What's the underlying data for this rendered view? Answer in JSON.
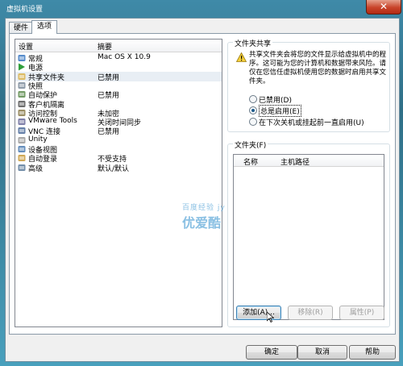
{
  "window": {
    "title": "虚拟机设置",
    "close": "✕"
  },
  "tabs": [
    {
      "label": "硬件"
    },
    {
      "label": "选项"
    }
  ],
  "list": {
    "headers": {
      "setting": "设置",
      "summary": "摘要"
    },
    "items": [
      {
        "name": "常规",
        "value": "Mac OS X 10.9",
        "icon": "general-icon",
        "color": "#3a78c2"
      },
      {
        "name": "电源",
        "value": "",
        "icon": "power-play-icon",
        "color": "#2e9e3a"
      },
      {
        "name": "共享文件夹",
        "value": "已禁用",
        "icon": "shared-folder-icon",
        "color": "#d9b24a"
      },
      {
        "name": "快照",
        "value": "",
        "icon": "snapshot-icon",
        "color": "#7a8a99"
      },
      {
        "name": "自动保护",
        "value": "已禁用",
        "icon": "autoprotect-icon",
        "color": "#5a8a4a"
      },
      {
        "name": "客户机隔离",
        "value": "",
        "icon": "isolation-icon",
        "color": "#555555"
      },
      {
        "name": "访问控制",
        "value": "未加密",
        "icon": "access-control-icon",
        "color": "#8a7a4a"
      },
      {
        "name": "VMware Tools",
        "value": "关闭时间同步",
        "icon": "vmware-tools-icon",
        "color": "#6a6a9a"
      },
      {
        "name": "VNC 连接",
        "value": "已禁用",
        "icon": "vnc-icon",
        "color": "#4a6a9a"
      },
      {
        "name": "Unity",
        "value": "",
        "icon": "unity-icon",
        "color": "#999999"
      },
      {
        "name": "设备视图",
        "value": "",
        "icon": "device-view-icon",
        "color": "#4a7ab0"
      },
      {
        "name": "自动登录",
        "value": "不受支持",
        "icon": "autologin-icon",
        "color": "#c89a3a"
      },
      {
        "name": "高级",
        "value": "默认/默认",
        "icon": "advanced-icon",
        "color": "#5a7a9a"
      }
    ]
  },
  "sharing": {
    "group_label": "文件夹共享",
    "warning": "共享文件夹会将您的文件显示给虚拟机中的程序。这可能为您的计算机和数据带来风险。请仅在您信任虚拟机使用您的数据时启用共享文件夹。",
    "options": [
      {
        "label": "已禁用(D)",
        "selected": false
      },
      {
        "label": "总是启用(E)",
        "selected": true
      },
      {
        "label": "在下次关机或挂起前一直启用(U)",
        "selected": false
      }
    ]
  },
  "folders": {
    "group_label": "文件夹(F)",
    "headers": {
      "name": "名称",
      "host_path": "主机路径"
    },
    "add": "添加(A)...",
    "remove": "移除(R)",
    "properties": "属性(P)"
  },
  "watermark": {
    "line1": "百度经验 jy",
    "line2": "优爱酷"
  },
  "footer": {
    "ok": "确定",
    "cancel": "取消",
    "help": "帮助"
  }
}
